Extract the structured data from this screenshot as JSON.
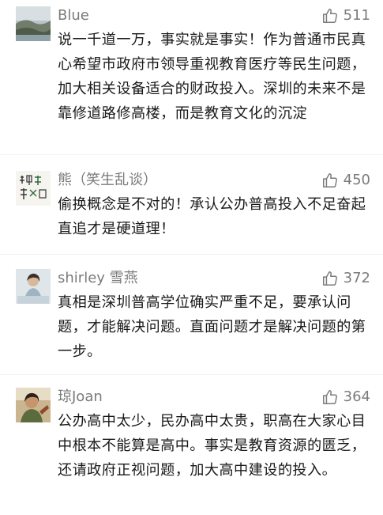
{
  "comments": [
    {
      "username": "Blue",
      "likes": "511",
      "content": "说一千道一万，事实就是事实！作为普通市民真心希望市政府市领导重视教育医疗等民生问题，加大相关设备适合的财政投入。深圳的未来不是靠修道路修高楼，而是教育文化的沉淀"
    },
    {
      "username": "熊（笑生乱谈）",
      "likes": "450",
      "content": "偷换概念是不对的！承认公办普高投入不足奋起直追才是硬道理！"
    },
    {
      "username": "shirley 雪燕",
      "likes": "372",
      "content": "真相是深圳普高学位确实严重不足，要承认问题，才能解决问题。直面问题才是解决问题的第一步。"
    },
    {
      "username": "琼Joan",
      "likes": "364",
      "content": "公办高中太少，民办高中太贵，职高在大家心目中根本不能算是高中。事实是教育资源的匮乏，还请政府正视问题，加大高中建设的投入。"
    }
  ],
  "icons": {
    "like": "thumbs-up-icon"
  },
  "colors": {
    "meta_text": "#7b7b7b",
    "body_text": "#1a1a1a"
  }
}
